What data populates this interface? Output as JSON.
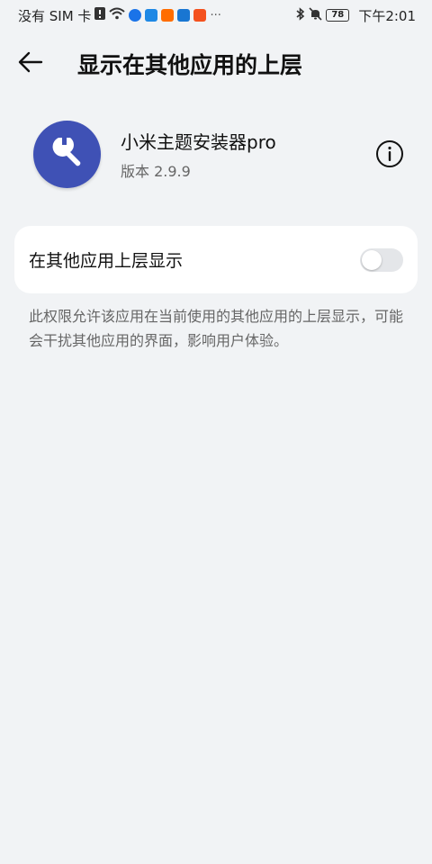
{
  "status_bar": {
    "carrier": "没有 SIM 卡",
    "time": "下午2:01",
    "battery": "78",
    "more": "···",
    "app_icons": [
      "alert-icon",
      "wifi-icon",
      "cloud-icon",
      "cloud-icon",
      "play-icon",
      "reader-icon",
      "app-icon"
    ],
    "colors": [
      "#1a73e8",
      "#1e88e5",
      "#ff6d00",
      "#1976d2",
      "#f4511e"
    ]
  },
  "header": {
    "title": "显示在其他应用的上层",
    "back_icon": "arrow-left-icon"
  },
  "app": {
    "name": "小米主题安装器pro",
    "version": "版本 2.9.9",
    "icon": "wrench-icon",
    "icon_color": "#3f51b5",
    "info_icon": "info-icon"
  },
  "permission": {
    "label": "在其他应用上层显示",
    "enabled": false
  },
  "description": "此权限允许该应用在当前使用的其他应用的上层显示，可能会干扰其他应用的界面，影响用户体验。"
}
